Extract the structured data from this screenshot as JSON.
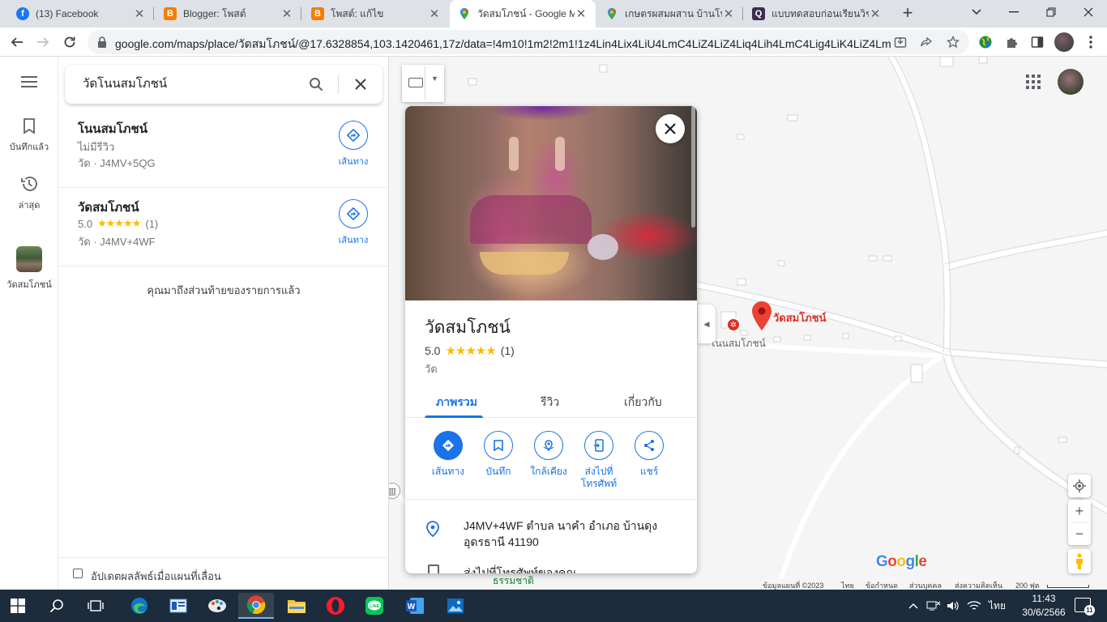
{
  "browser": {
    "tabs": [
      {
        "title": "(13) Facebook",
        "icon": "facebook-icon",
        "color": "#1877f2",
        "glyph": "f"
      },
      {
        "title": "Blogger: โพสต์",
        "icon": "blogger-icon",
        "color": "#f57d00",
        "glyph": "B"
      },
      {
        "title": "โพสต์: แก้ไข",
        "icon": "blogger-icon",
        "color": "#f57d00",
        "glyph": "B"
      },
      {
        "title": "วัดสมโภชน์ - Google Ma",
        "icon": "google-maps-icon",
        "color": "#34a853",
        "glyph": ""
      },
      {
        "title": "เกษตรผสมผสาน บ้านโนนสม",
        "icon": "google-maps-icon",
        "color": "#34a853",
        "glyph": ""
      },
      {
        "title": "แบบทดสอบก่อนเรียนวิชา",
        "icon": "quizizz-icon",
        "color": "#3d2c4e",
        "glyph": "Q"
      }
    ],
    "active_tab": 3,
    "url": "google.com/maps/place/วัดสมโภชน์/@17.6328854,103.1420461,17z/data=!4m10!1m2!2m1!1z4Lin4Lix4LiU4LmC4LiZ4LiZ4Liq4Lih4LmC4Lig4LiK4LiZ4LmM!..."
  },
  "rail": {
    "saved_label": "บันทึกแล้ว",
    "recent_label": "ล่าสุด",
    "place_label": "วัดสมโภชน์"
  },
  "search": {
    "query": "วัดโนนสมโภชน์"
  },
  "results": [
    {
      "name": "โนนสมโภชน์",
      "reviews_text": "ไม่มีรีวิว",
      "rating": "",
      "stars": "",
      "count": "",
      "detail": "วัด · J4MV+5QG",
      "dir_label": "เส้นทาง"
    },
    {
      "name": "วัดสมโภชน์",
      "reviews_text": "",
      "rating": "5.0",
      "stars": "★★★★★",
      "count": "(1)",
      "detail": "วัด · J4MV+4WF",
      "dir_label": "เส้นทาง"
    }
  ],
  "end_of_list": "คุณมาถึงส่วนท้ายของรายการแล้ว",
  "update_checkbox_label": "อัปเดตผลลัพธ์เมื่อแผนที่เลื่อน",
  "card": {
    "title": "วัดสมโภชน์",
    "rating": "5.0",
    "stars": "★★★★★",
    "count": "(1)",
    "category": "วัด",
    "tabs": [
      "ภาพรวม",
      "รีวิว",
      "เกี่ยวกับ"
    ],
    "selected_tab": 0,
    "actions": [
      {
        "label": "เส้นทาง",
        "icon": "directions-icon"
      },
      {
        "label": "บันทึก",
        "icon": "bookmark-icon"
      },
      {
        "label": "ใกล้เคียง",
        "icon": "nearby-icon"
      },
      {
        "label": "ส่งไปที่โทรศัพท์",
        "icon": "send-to-phone-icon"
      },
      {
        "label": "แชร์",
        "icon": "share-icon"
      }
    ],
    "address": "J4MV+4WF ตำบล นาคำ อำเภอ บ้านดุง อุดรธานี 41190",
    "send_row": "ส่งไปที่โทรศัพท์ของคุณ"
  },
  "map": {
    "pin_label": "วัดสมโภชน์",
    "poi_label": "โนนสมโภชน์",
    "road_label": "ธรรมชาติ",
    "logo": "Google",
    "attribution": [
      "ข้อมูลแผนที่ ©2023",
      "ไทย",
      "ข้อกำหนด",
      "ส่วนบุคคล",
      "ส่งความคิดเห็น",
      "200 ฟุต"
    ]
  },
  "taskbar": {
    "lang": "ไทย",
    "time": "11:43",
    "date": "30/6/2566",
    "notifications": "11"
  },
  "colors": {
    "accent": "#1a73e8",
    "pin": "#ea4335",
    "star": "#fbbc04"
  }
}
